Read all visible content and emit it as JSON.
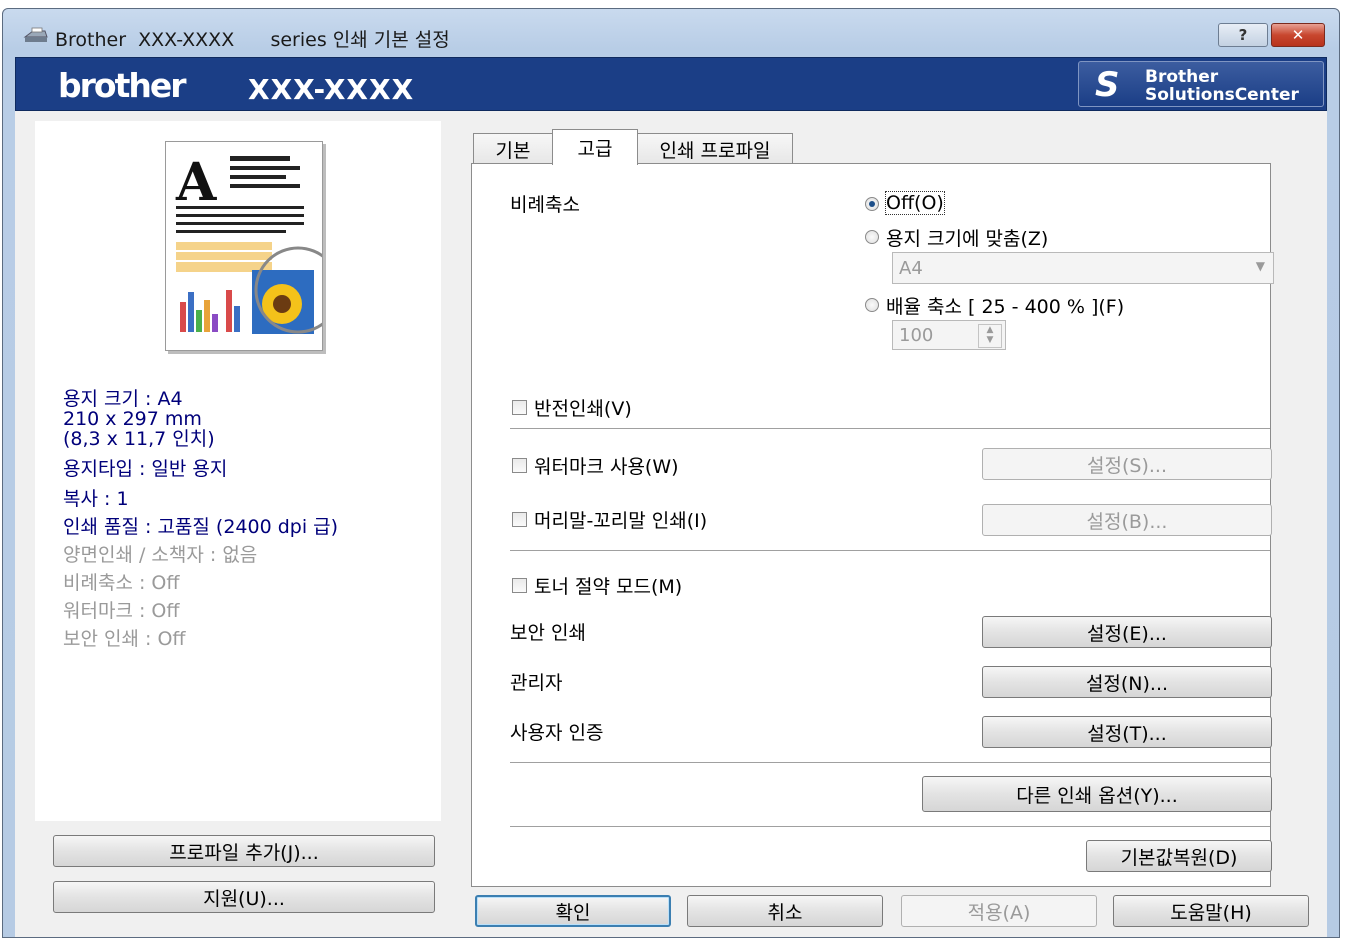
{
  "window": {
    "title_prefix": "Brother",
    "title_model": "XXX-XXXX",
    "title_suffix": "series 인쇄 기본 설정",
    "help_label": "?",
    "close_label": "x"
  },
  "banner": {
    "brand": "brother",
    "model": "XXX-XXXX",
    "solutions_line1": "Brother",
    "solutions_line2": "SolutionsCenter",
    "accent_color": "#1b3e86"
  },
  "summary": {
    "paper_size": "용지 크기 : A4",
    "paper_dims_mm": "210 x 297 mm",
    "paper_dims_in": "(8,3 x 11,7 인치)",
    "media_type": "용지타입 : 일반 용지",
    "copies": "복사 : 1",
    "quality": "인쇄 품질 : 고품질 (2400 dpi 급)",
    "duplex": "양면인쇄 / 소책자 : 없음",
    "scaling": "비례축소 : Off",
    "watermark": "워터마크 : Off",
    "secure": "보안 인쇄 : Off"
  },
  "left_buttons": {
    "add_profile": "프로파일 추가(J)...",
    "support": "지원(U)..."
  },
  "tabs": [
    "기본",
    "고급",
    "인쇄 프로파일"
  ],
  "advanced": {
    "scaling_label": "비례축소",
    "scaling_off": "Off(O)",
    "scaling_fit": "용지 크기에 맞춤(Z)",
    "paper_select": "A4",
    "scaling_free": "배율 축소 [ 25 - 400 % ](F)",
    "scale_value": "100",
    "reverse_print": "반전인쇄(V)",
    "use_watermark": "워터마크 사용(W)",
    "watermark_settings": "설정(S)...",
    "header_footer": "머리말-꼬리말 인쇄(I)",
    "header_footer_settings": "설정(B)...",
    "toner_save": "토너 절약 모드(M)",
    "secure_print": "보안 인쇄",
    "secure_settings": "설정(E)...",
    "administrator": "관리자",
    "admin_settings": "설정(N)...",
    "user_auth": "사용자 인증",
    "user_auth_settings": "설정(T)...",
    "other_options": "다른 인쇄 옵션(Y)...",
    "defaults": "기본값복원(D)"
  },
  "footer": {
    "ok": "확인",
    "cancel": "취소",
    "apply": "적용(A)",
    "help": "도움말(H)"
  }
}
